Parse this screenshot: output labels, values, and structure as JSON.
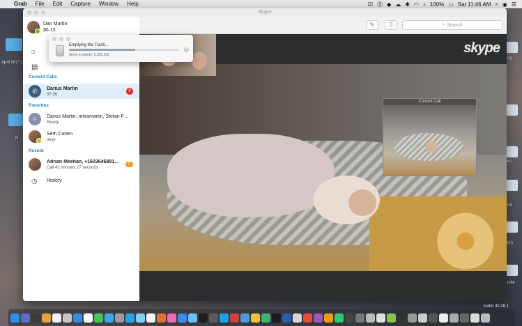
{
  "menubar": {
    "app_name": "Grab",
    "items": [
      "File",
      "Edit",
      "Capture",
      "Window",
      "Help"
    ],
    "battery": "100%",
    "clock": "Sat 11:46 AM"
  },
  "desktop": {
    "labels": [
      "April 2017 p",
      "N",
      "og",
      "ks",
      "ful",
      "zy's",
      "bsite",
      "ksdm 30.28.1"
    ]
  },
  "window": {
    "title": "Skype",
    "search_placeholder": "Search"
  },
  "profile": {
    "name": "Dan Martin",
    "balance": "$6.13"
  },
  "sidebar": {
    "current_calls_label": "Current Calls",
    "current_call": {
      "name": "Darius Martin",
      "duration": "07:36"
    },
    "favorites_label": "Favorites",
    "favorites": [
      {
        "name": "Darius Martin, mitramartin, Stefan Fa...",
        "status": "Ready"
      },
      {
        "name": "Seth Cohen",
        "status": "okay"
      }
    ],
    "recent_label": "Recent",
    "recent": [
      {
        "name": "Adrian Meehan, +1603646891...",
        "detail": "Call 42 minutes 27 seconds",
        "badge": "2"
      }
    ],
    "history_label": "History"
  },
  "trash_dialog": {
    "title": "Emptying the Trash...",
    "items_text": "Items to delete: 5,283,282",
    "progress": 0.6
  },
  "video": {
    "logo": "skype",
    "current_call_label": "Current Call"
  },
  "colors": {
    "accent": "#1a7fc0",
    "hangup": "#e0232b",
    "badge": "#f39c12",
    "active_row": "#dfeef8"
  }
}
